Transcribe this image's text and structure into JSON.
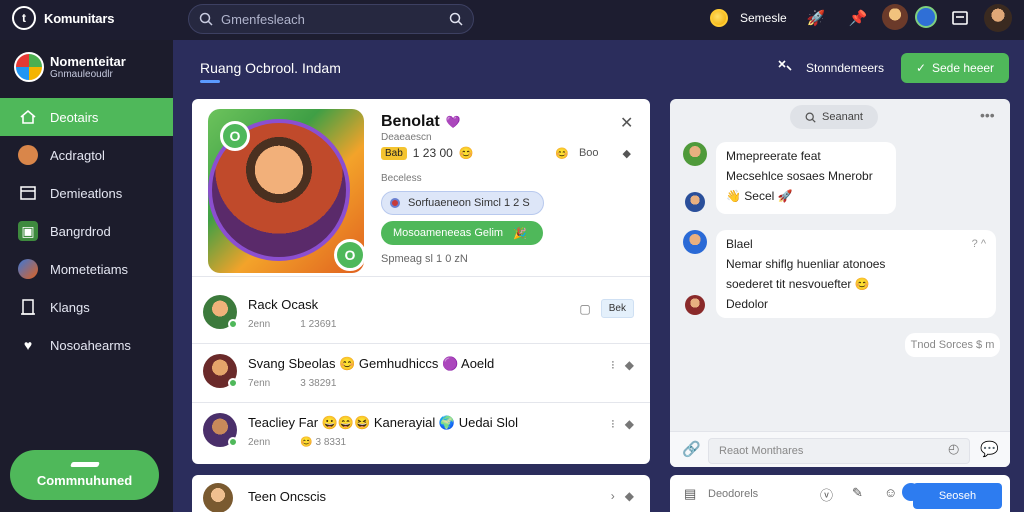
{
  "app": {
    "name": "Komunitars",
    "logo_glyph": "t"
  },
  "search": {
    "placeholder": "Gmenfesleach"
  },
  "topbar": {
    "coin_label": "Semesle"
  },
  "profile": {
    "name": "Nomenteitar",
    "subtitle": "Gnmauleoudlr"
  },
  "sidebar": {
    "items": [
      {
        "label": "Deotairs",
        "icon": "home-icon",
        "active": true
      },
      {
        "label": "Acdragtol",
        "icon": "avatar-icon",
        "active": false
      },
      {
        "label": "Demieatlons",
        "icon": "list-icon",
        "active": false
      },
      {
        "label": "Bangrdrod",
        "icon": "media-icon",
        "active": false
      },
      {
        "label": "Mometetiams",
        "icon": "globe-icon",
        "active": false
      },
      {
        "label": "Klangs",
        "icon": "doc-icon",
        "active": false
      },
      {
        "label": "Nosoahearms",
        "icon": "heart-icon",
        "active": false
      }
    ],
    "cta_label": "Commnuhuned"
  },
  "main": {
    "title": "Ruang Ocbrool. Indam",
    "filter_label": "Stonndemeers",
    "action_label": "Sede heeer"
  },
  "hero": {
    "name": "Benolat",
    "subtitle": "Deaeaescn",
    "badge": "Bab",
    "stat": "1 23 00",
    "stat_right": "Boo",
    "label": "Beceless",
    "pill_blue": "Sorfuaeneon Simcl 1 2 S",
    "pill_green": "Mosoameneeas Gelim",
    "footer": "Spmeag sl 1 0 zN"
  },
  "rows": [
    {
      "title": "Rack Ocask",
      "sub1": "2enn",
      "sub2": "1 23691",
      "action": "Bek"
    },
    {
      "title": "Svang Sbeolas 😊 Gemhudhiccs 🟣 Aoeld",
      "sub1": "7enn",
      "sub2": "3 38291",
      "action": ""
    },
    {
      "title": "Teacliey Far 😀😄😆 Kanerayial 🌍 Uedai Slol",
      "sub1": "2enn",
      "sub2": "😊 3 8331",
      "action": ""
    }
  ],
  "bottom_row": {
    "title": "Teen Oncscis"
  },
  "chat": {
    "search_label": "Seanant",
    "messages": [
      {
        "lines": [
          "Mmepreerate feat",
          "Mecsehlce sosaes Mnerobr",
          "👋 Secel 🚀"
        ]
      },
      {
        "lines": [
          "Blael",
          "Nemar shiflg huenliar atonoes",
          "soederet tit nesvouefter 😊",
          "Dedolor"
        ]
      }
    ],
    "time_label": "Tnod Sorces $ m",
    "input_placeholder": "Reaot Monthares",
    "bottom_label": "Deodorels",
    "send_label": "Seoseh"
  },
  "colors": {
    "accent_green": "#4fb85a",
    "accent_blue": "#2d7cf0",
    "topbar": "#1d1d30",
    "sidebar": "#1c1c2c",
    "page_bg": "#2b2d5c"
  }
}
